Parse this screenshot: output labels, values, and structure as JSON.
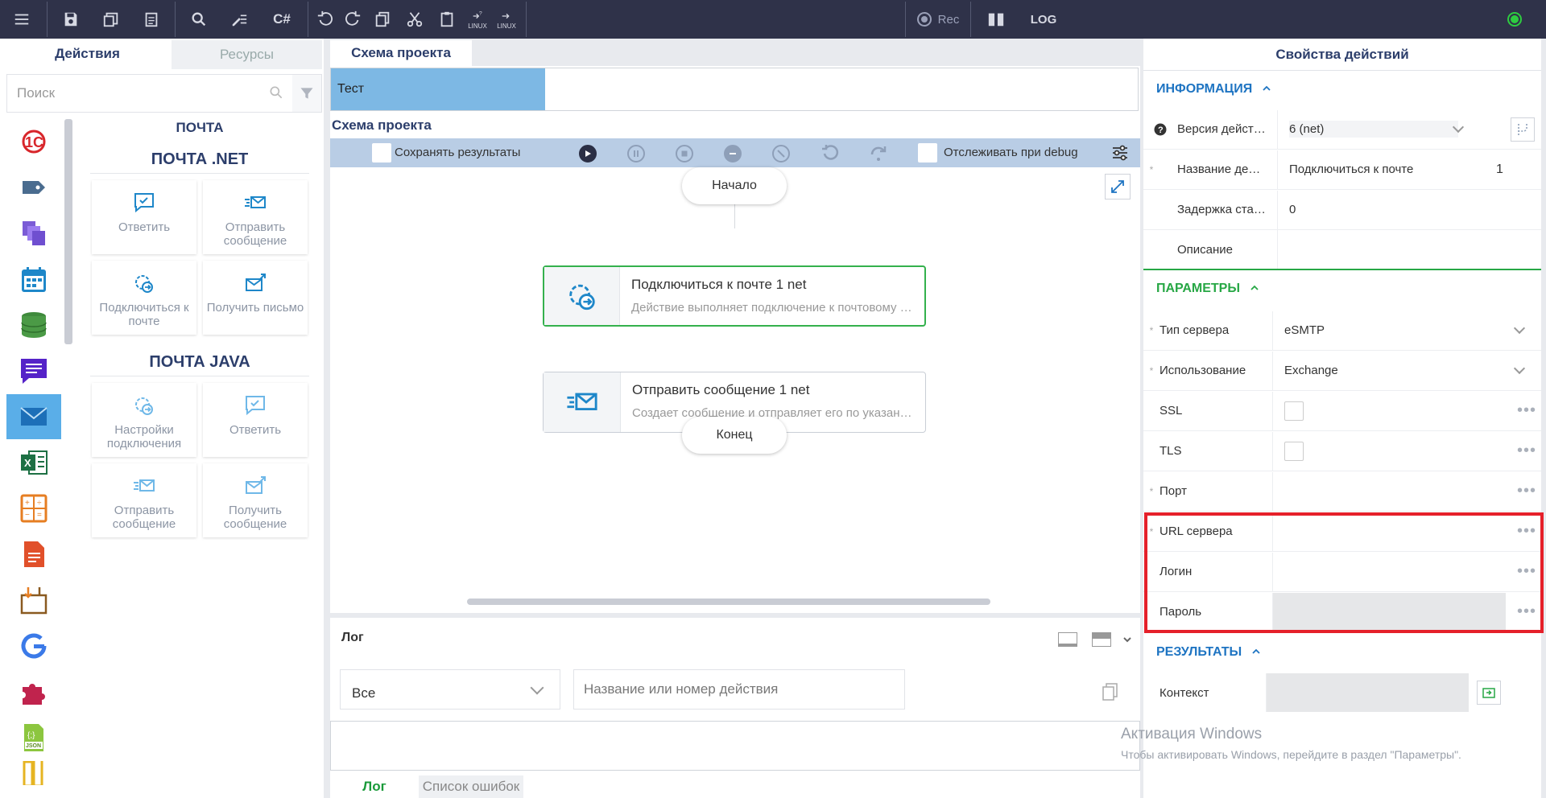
{
  "toolbar": {
    "rec_label": "Rec",
    "log_label": "LOG",
    "cs_label": "C#",
    "linux_label": "LINUX"
  },
  "left": {
    "tabs": [
      "Действия",
      "Ресурсы"
    ],
    "search_placeholder": "Поиск",
    "category_title": "ПОЧТА",
    "groups": [
      {
        "title": "ПОЧТА .NET",
        "items": [
          "Ответить",
          "Отправить сообщение",
          "Подключиться к почте",
          "Получить письмо"
        ]
      },
      {
        "title": "ПОЧТА JAVA",
        "items": [
          "Настройки подключения",
          "Ответить",
          "Отправить сообщение",
          "Получить сообщение"
        ]
      }
    ]
  },
  "center": {
    "tab": "Схема проекта",
    "doc_tab": "Тест",
    "schema_label": "Схема проекта",
    "save_results": "Сохранять результаты",
    "track_debug": "Отслеживать при debug",
    "start": "Начало",
    "end": "Конец",
    "nodes": [
      {
        "title": "Подключиться к почте  1  net",
        "desc": "Действие выполняет подключение к почтовому серверу"
      },
      {
        "title": "Отправить сообщение  1  net",
        "desc": "Создает сообщение и отправляет его по указанному адресу"
      }
    ]
  },
  "log": {
    "title": "Лог",
    "filter_value": "Все",
    "search_placeholder": "Название или номер действия",
    "tabs": [
      "Лог",
      "Список ошибок"
    ]
  },
  "right": {
    "title": "Свойства действий",
    "info_section": "ИНФОРМАЦИЯ",
    "info_rows": [
      {
        "name": "Версия действия",
        "value": "6 (net)"
      },
      {
        "name": "Название действия",
        "value": "Подключиться к почте",
        "extra": "1"
      },
      {
        "name": "Задержка старта",
        "value": "0"
      },
      {
        "name": "Описание",
        "value": ""
      }
    ],
    "params_section": "ПАРАМЕТРЫ",
    "params_rows": [
      {
        "name": "Тип сервера",
        "value": "eSMTP"
      },
      {
        "name": "Использование",
        "value": "Exchange"
      },
      {
        "name": "SSL",
        "value": ""
      },
      {
        "name": "TLS",
        "value": ""
      },
      {
        "name": "Порт",
        "value": ""
      },
      {
        "name": "URL сервера",
        "value": ""
      },
      {
        "name": "Логин",
        "value": ""
      },
      {
        "name": "Пароль",
        "value": ""
      }
    ],
    "results_section": "РЕЗУЛЬТАТЫ",
    "results_rows": [
      {
        "name": "Контекст",
        "value": ""
      }
    ]
  },
  "watermark": {
    "line1": "Активация Windows",
    "line2": "Чтобы активировать Windows, перейдите в раздел \"Параметры\"."
  },
  "colors": {
    "topbar": "#2f3249",
    "accent_blue": "#5aaee8",
    "node_active_border": "#34b14d",
    "highlight": "#e5202a",
    "section_green": "#27a745",
    "section_blue": "#1e74c2"
  }
}
